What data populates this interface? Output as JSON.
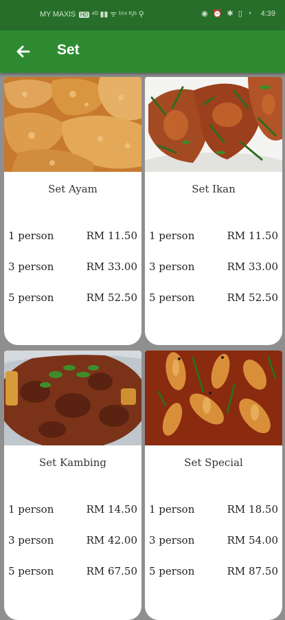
{
  "status": {
    "carrier": "MY MAXIS",
    "network_tag": "HD",
    "signal_text": "⁴ᴳ ▮▮ ᯤ ¹⁵⁴ ᴷ/ˢ ⚲",
    "icons": "◉ ⏰ ✱ ▯ ◔",
    "time": "4:39"
  },
  "app_bar": {
    "title": "Set"
  },
  "menu": [
    {
      "name": "Set Ayam",
      "options": [
        {
          "label": "1 person",
          "price": "RM 11.50"
        },
        {
          "label": "3 person",
          "price": "RM 33.00"
        },
        {
          "label": "5 person",
          "price": "RM 52.50"
        }
      ]
    },
    {
      "name": "Set Ikan",
      "options": [
        {
          "label": "1 person",
          "price": "RM 11.50"
        },
        {
          "label": "3 person",
          "price": "RM 33.00"
        },
        {
          "label": "5 person",
          "price": "RM 52.50"
        }
      ]
    },
    {
      "name": "Set Kambing",
      "options": [
        {
          "label": "1 person",
          "price": "RM 14.50"
        },
        {
          "label": "3 person",
          "price": "RM 42.00"
        },
        {
          "label": "5 person",
          "price": "RM 67.50"
        }
      ]
    },
    {
      "name": "Set Special",
      "options": [
        {
          "label": "1 person",
          "price": "RM 18.50"
        },
        {
          "label": "3 person",
          "price": "RM 54.00"
        },
        {
          "label": "5 person",
          "price": "RM 87.50"
        }
      ]
    }
  ]
}
